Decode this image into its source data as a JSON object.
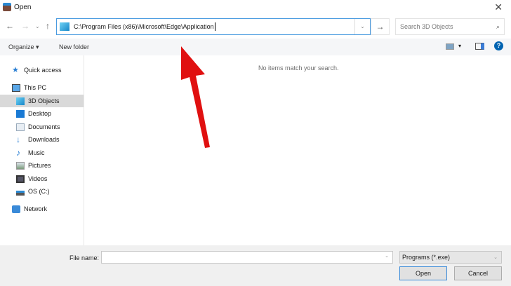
{
  "window": {
    "title": "Open"
  },
  "address": {
    "path": "C:\\Program Files (x86)\\Microsoft\\Edge\\Application"
  },
  "search": {
    "placeholder": "Search 3D Objects"
  },
  "toolbar": {
    "organize": "Organize",
    "new_folder": "New folder"
  },
  "sidebar": {
    "items": [
      {
        "label": "Quick access",
        "icon": "star-icon"
      },
      {
        "label": "This PC",
        "icon": "computer-icon"
      },
      {
        "label": "3D Objects",
        "icon": "cube-icon"
      },
      {
        "label": "Desktop",
        "icon": "desktop-icon"
      },
      {
        "label": "Documents",
        "icon": "document-icon"
      },
      {
        "label": "Downloads",
        "icon": "download-icon"
      },
      {
        "label": "Music",
        "icon": "music-icon"
      },
      {
        "label": "Pictures",
        "icon": "picture-icon"
      },
      {
        "label": "Videos",
        "icon": "video-icon"
      },
      {
        "label": "OS (C:)",
        "icon": "drive-icon"
      },
      {
        "label": "Network",
        "icon": "network-icon"
      }
    ]
  },
  "content": {
    "empty_message": "No items match your search."
  },
  "bottom": {
    "file_name_label": "File name:",
    "file_name_value": "",
    "filter": "Programs (*.exe)",
    "open": "Open",
    "cancel": "Cancel"
  },
  "colors": {
    "accent": "#0063b1",
    "annotation": "#e01010"
  }
}
